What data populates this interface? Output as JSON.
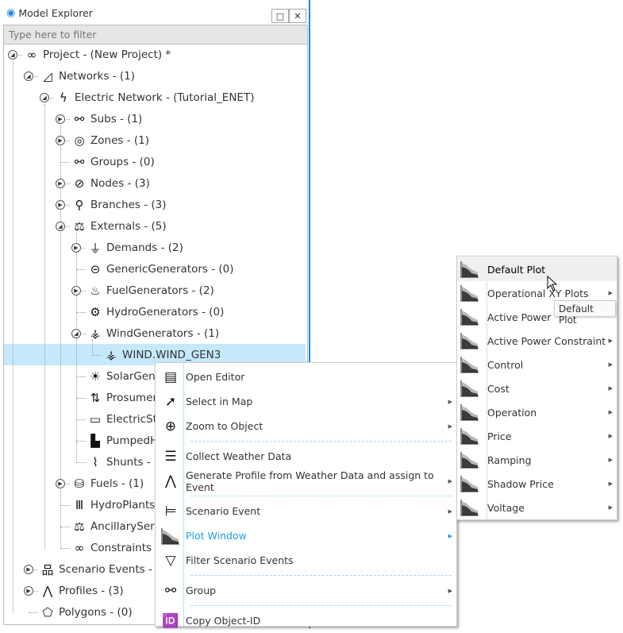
{
  "window": {
    "title": "Model Explorer",
    "restore_icon": "restore-icon",
    "close_icon": "close-icon"
  },
  "filter": {
    "placeholder": "Type here to filter",
    "value": ""
  },
  "tree": [
    {
      "label": "Project - (New Project) *",
      "icon": "infinity-icon",
      "level": 0,
      "toggle": "expanded"
    },
    {
      "label": "Networks - (1)",
      "icon": "network-icon",
      "level": 1,
      "toggle": "expanded"
    },
    {
      "label": "Electric Network - (Tutorial_ENET)",
      "icon": "lightning-icon",
      "level": 2,
      "toggle": "expanded"
    },
    {
      "label": "Subs - (1)",
      "icon": "subs-icon",
      "level": 3,
      "toggle": "collapsed"
    },
    {
      "label": "Zones - (1)",
      "icon": "zones-icon",
      "level": 3,
      "toggle": "collapsed"
    },
    {
      "label": "Groups - (0)",
      "icon": "groups-icon",
      "level": 3,
      "toggle": "none"
    },
    {
      "label": "Nodes - (3)",
      "icon": "nodes-icon",
      "level": 3,
      "toggle": "collapsed"
    },
    {
      "label": "Branches - (3)",
      "icon": "branches-icon",
      "level": 3,
      "toggle": "collapsed"
    },
    {
      "label": "Externals - (5)",
      "icon": "externals-icon",
      "level": 3,
      "toggle": "expanded"
    },
    {
      "label": "Demands - (2)",
      "icon": "plug-icon",
      "level": 4,
      "toggle": "collapsed"
    },
    {
      "label": "GenericGenerators - (0)",
      "icon": "generator-icon",
      "level": 4,
      "toggle": "none"
    },
    {
      "label": "FuelGenerators - (2)",
      "icon": "fuel-generator-icon",
      "level": 4,
      "toggle": "collapsed"
    },
    {
      "label": "HydroGenerators - (0)",
      "icon": "hydro-generator-icon",
      "level": 4,
      "toggle": "none"
    },
    {
      "label": "WindGenerators - (1)",
      "icon": "wind-turbine-icon",
      "level": 4,
      "toggle": "expanded"
    },
    {
      "label": "WIND.WIND_GEN3",
      "icon": "wind-turbine-icon",
      "level": 5,
      "toggle": "none",
      "selected": true
    },
    {
      "label": "SolarGene",
      "icon": "solar-panel-icon",
      "level": 4,
      "toggle": "none"
    },
    {
      "label": "Prosumer",
      "icon": "prosumer-icon",
      "level": 4,
      "toggle": "none"
    },
    {
      "label": "ElectricSt",
      "icon": "battery-icon",
      "level": 4,
      "toggle": "none"
    },
    {
      "label": "PumpedH",
      "icon": "pumped-hydro-icon",
      "level": 4,
      "toggle": "none"
    },
    {
      "label": "Shunts - (",
      "icon": "shunt-icon",
      "level": 4,
      "toggle": "none"
    },
    {
      "label": "Fuels - (1)",
      "icon": "fuel-barrel-icon",
      "level": 3,
      "toggle": "collapsed"
    },
    {
      "label": "HydroPlants",
      "icon": "dam-icon",
      "level": 3,
      "toggle": "none"
    },
    {
      "label": "AncillaryServ",
      "icon": "scales-icon",
      "level": 3,
      "toggle": "none"
    },
    {
      "label": "Constraints -",
      "icon": "link-icon",
      "level": 3,
      "toggle": "none"
    },
    {
      "label": "Scenario Events - (",
      "icon": "hierarchy-icon",
      "level": 1,
      "toggle": "collapsed"
    },
    {
      "label": "Profiles - (3)",
      "icon": "profile-curve-icon",
      "level": 1,
      "toggle": "collapsed"
    },
    {
      "label": "Polygons - (0)",
      "icon": "pentagon-icon",
      "level": 1,
      "toggle": "none"
    }
  ],
  "context_menu": [
    {
      "label": "Open Editor",
      "icon": "editor-icon",
      "submenu": false
    },
    {
      "label": "Select in Map",
      "icon": "map-select-icon",
      "submenu": true
    },
    {
      "label": "Zoom to Object",
      "icon": "zoom-in-icon",
      "submenu": true,
      "separator_after": true
    },
    {
      "label": "Collect Weather Data",
      "icon": "database-icon",
      "submenu": false
    },
    {
      "label": "Generate Profile from Weather Data and assign to Event",
      "icon": "profile-curve-icon",
      "submenu": true,
      "separator_after": true
    },
    {
      "label": "Scenario Event",
      "icon": "scenario-event-icon",
      "submenu": true
    },
    {
      "label": "Plot Window",
      "icon": "plot-icon",
      "submenu": true,
      "active": true
    },
    {
      "label": "Filter Scenario Events",
      "icon": "filter-icon",
      "submenu": false,
      "separator_after": true
    },
    {
      "label": "Group",
      "icon": "groups-icon",
      "submenu": true,
      "separator_after": true
    },
    {
      "label": "Copy Object-ID",
      "icon": "id-icon",
      "submenu": false
    }
  ],
  "plot_submenu": [
    {
      "label": "Default Plot",
      "submenu": false,
      "hovered": true
    },
    {
      "label": "Operational XY Plots",
      "submenu": true
    },
    {
      "label": "Active Power",
      "submenu": false
    },
    {
      "label": "Active Power Constraint",
      "submenu": true
    },
    {
      "label": "Control",
      "submenu": true
    },
    {
      "label": "Cost",
      "submenu": true
    },
    {
      "label": "Operation",
      "submenu": true
    },
    {
      "label": "Price",
      "submenu": true
    },
    {
      "label": "Ramping",
      "submenu": true
    },
    {
      "label": "Shadow Price",
      "submenu": true
    },
    {
      "label": "Voltage",
      "submenu": true
    }
  ],
  "tooltip": "Default Plot",
  "colors": {
    "accent": "#1e88e5",
    "selection": "#c5e9fb",
    "active_menu_text": "#1ea0e6",
    "menu_hover": "#eef0f0"
  }
}
